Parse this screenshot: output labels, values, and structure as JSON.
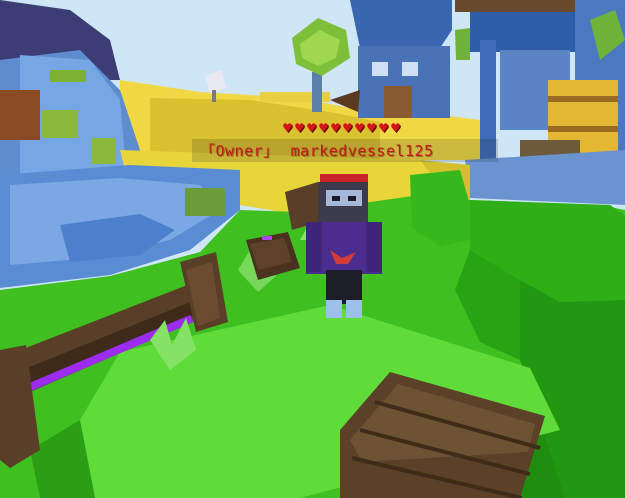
{
  "player": {
    "rank_label": "「Owner」",
    "username": "markedvessel125",
    "health_hearts": 10
  },
  "colors": {
    "nametag_text": "#c41818",
    "heart": "#d21515",
    "grass": "#3fc020",
    "sky": "#cfe6f7"
  },
  "icons": {
    "heart": "♥"
  }
}
